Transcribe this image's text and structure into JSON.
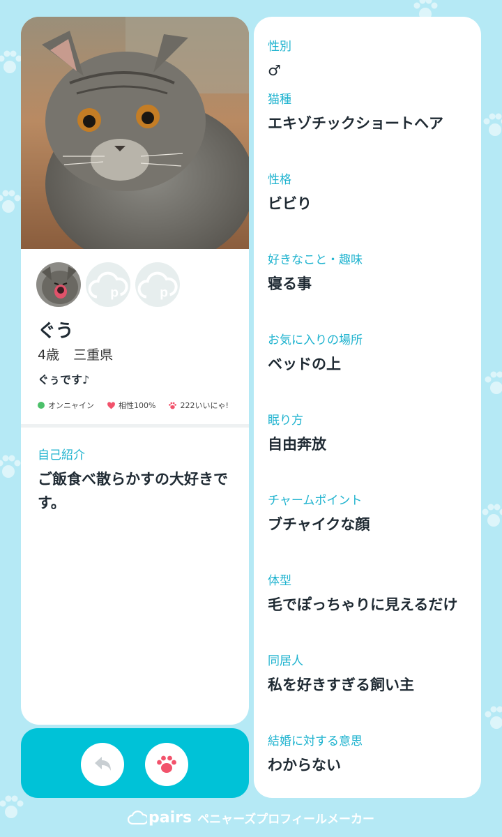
{
  "profile": {
    "name": "ぐう",
    "age": "4歳",
    "location": "三重県",
    "tagline": "ぐぅです♪",
    "status": "オンニャイン",
    "compatibility": "相性100%",
    "likes": "222いいにゃ!",
    "intro_label": "自己紹介",
    "intro_text": "ご飯食べ散らかすの大好きです。"
  },
  "details": [
    {
      "label": "性別",
      "value": "♂"
    },
    {
      "label": "猫種",
      "value": "エキゾチックショートヘア"
    },
    {
      "label": "性格",
      "value": "ビビり"
    },
    {
      "label": "好きなこと・趣味",
      "value": "寝る事"
    },
    {
      "label": "お気に入りの場所",
      "value": "ベッドの上"
    },
    {
      "label": "眠り方",
      "value": "自由奔放"
    },
    {
      "label": "チャームポイント",
      "value": "ブチャイクな顔"
    },
    {
      "label": "体型",
      "value": "毛でぽっちゃりに見えるだけ"
    },
    {
      "label": "同居人",
      "value": "私を好きすぎる飼い主"
    },
    {
      "label": "結婚に対する意思",
      "value": "わからない"
    }
  ],
  "footer": {
    "logo": "pairs",
    "text": "ペニャーズプロフィールメーカー"
  },
  "colors": {
    "accent": "#00c2d7",
    "label": "#1fb3cf",
    "background": "#b5e9f5",
    "like": "#f2526b",
    "online": "#4cc06a"
  },
  "icons": [
    "back-arrow-icon",
    "paw-icon",
    "heart-icon",
    "cloud-p-icon",
    "online-dot-icon"
  ]
}
